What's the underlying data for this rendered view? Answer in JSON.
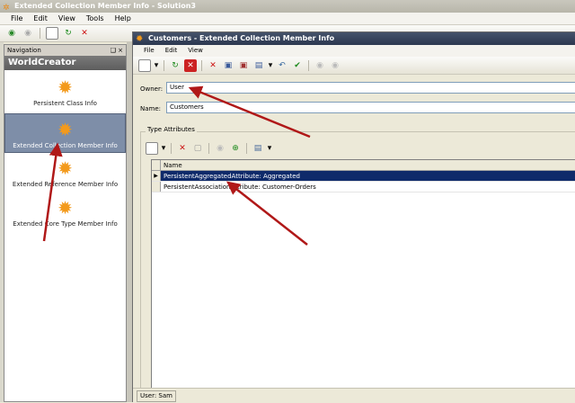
{
  "outer_window": {
    "title": "Extended Collection Member Info - Solution3"
  },
  "outer_menu": [
    "File",
    "Edit",
    "View",
    "Tools",
    "Help"
  ],
  "navigation": {
    "header": "Navigation",
    "header_buttons": "❑ ×",
    "group_title": "WorldCreator",
    "items": [
      {
        "label": "Persistent Class Info"
      },
      {
        "label": "Extended Collection Member Info"
      },
      {
        "label": "Extended Reference Member Info"
      },
      {
        "label": "Extended Core Type Member Info"
      }
    ],
    "selected_index": 1
  },
  "child_window": {
    "title": "Customers - Extended Collection Member Info",
    "menu": [
      "File",
      "Edit",
      "View"
    ],
    "owner_label": "Owner:",
    "owner_value": "User",
    "name_label": "Name:",
    "name_value": "Customers",
    "group_label": "Type Attributes",
    "grid": {
      "column": "Name",
      "rows": [
        {
          "name": "PersistentAggregatedAttribute: Aggregated",
          "selected": true,
          "indicator": "▶"
        },
        {
          "name": "PersistentAssociationAttribute: Customer-Orders",
          "selected": false,
          "indicator": ""
        }
      ]
    },
    "status": "User: Sam"
  },
  "colors": {
    "accent": "#f39a1c",
    "selection": "#0f2a6a",
    "arrow": "#b01818"
  }
}
